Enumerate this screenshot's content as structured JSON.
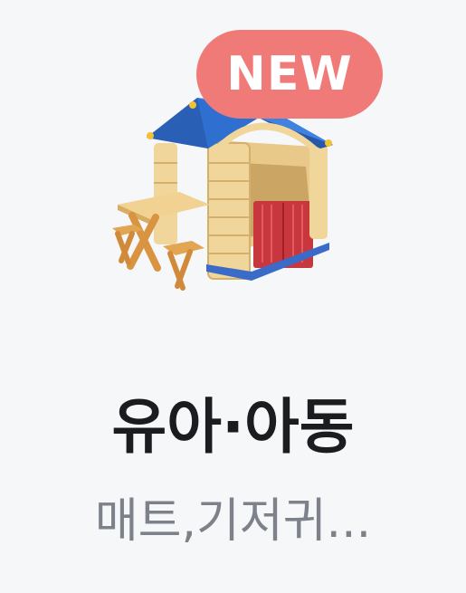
{
  "badge": {
    "label": "NEW",
    "color": "#f07a78"
  },
  "image": {
    "icon": "playhouse-icon"
  },
  "category": {
    "title": "유아·아동",
    "subtitle": "매트,기저귀..."
  },
  "colors": {
    "background": "#f6f7f9",
    "title": "#1a1c20",
    "subtitle": "#7d828a"
  }
}
